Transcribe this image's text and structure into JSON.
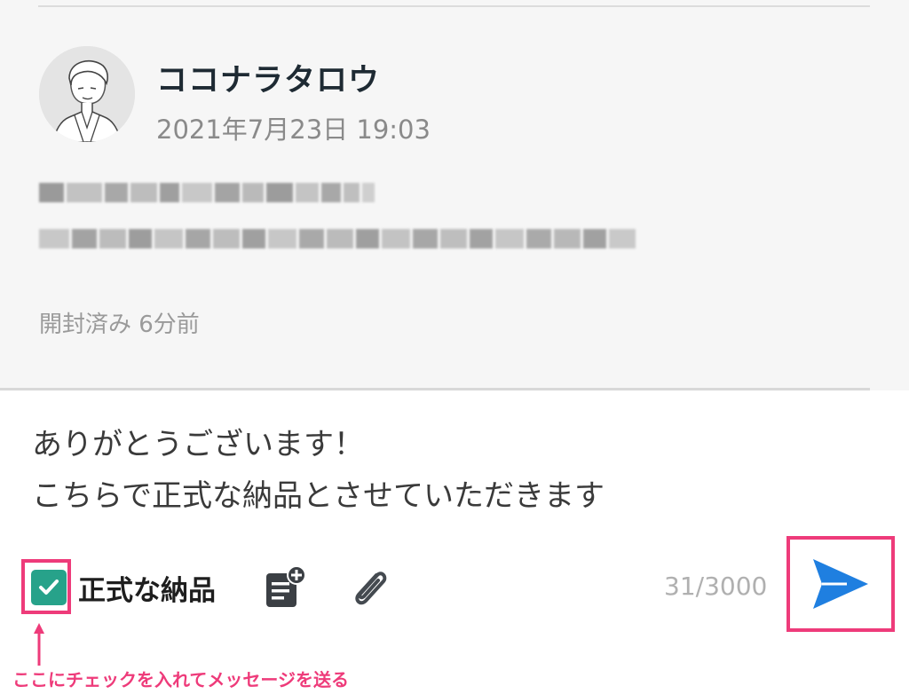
{
  "message": {
    "sender_name": "ココナラタロウ",
    "timestamp": "2021年7月23日 19:03",
    "read_status": "開封済み 6分前"
  },
  "composer": {
    "lines": [
      "ありがとうございます！",
      "こちらで正式な納品とさせていただきます"
    ],
    "official_delivery_label": "正式な納品",
    "official_delivery_checked": true,
    "char_count": "31/3000"
  },
  "annotation": {
    "text": "ここにチェックを入れてメッセージを送る",
    "color": "#ee3b7a"
  },
  "icons": {
    "check": "checkbox-checked-icon",
    "template": "add-template-icon",
    "attach": "paperclip-icon",
    "send": "send-icon"
  },
  "colors": {
    "checkbox": "#27a28a",
    "send": "#1f7fe0",
    "highlight": "#ee3b7a"
  }
}
